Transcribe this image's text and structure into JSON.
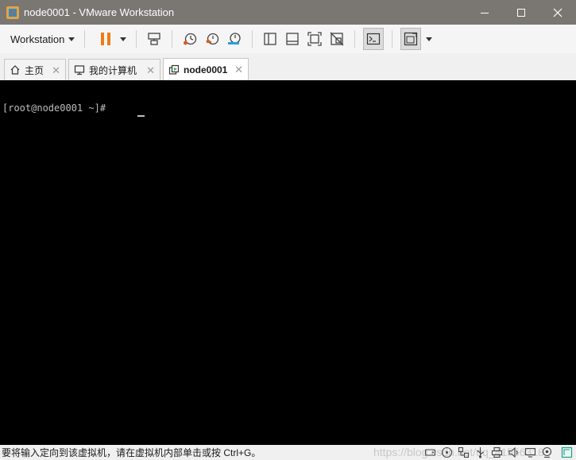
{
  "window": {
    "title": "node0001 - VMware Workstation"
  },
  "toolbar": {
    "workstation_label": "Workstation",
    "buttons": [
      "power-pause-icon",
      "send-ctrl-alt-del-icon",
      "snapshot-icon",
      "revert-snapshot-icon",
      "snapshot-manager-icon",
      "show-library-icon",
      "thumbnail-bar-icon",
      "full-screen-icon",
      "unity-icon",
      "console-view-icon",
      "stretch-guest-icon"
    ]
  },
  "tabs": [
    {
      "label": "主页",
      "icon": "home-icon"
    },
    {
      "label": "我的计算机",
      "icon": "computer-icon"
    },
    {
      "label": "node0001",
      "icon": "vm-icon",
      "selected": true
    }
  ],
  "console": {
    "prompt": "[root@node0001 ~]# "
  },
  "status": {
    "message": "要将输入定向到该虚拟机，请在虚拟机内部单击或按 Ctrl+G。",
    "watermark": "https://blog.csdn.net/qq_41556318"
  },
  "colors": {
    "titlebar": "#7a7672",
    "pause_accent": "#f07b16",
    "console_bg": "#000000"
  }
}
